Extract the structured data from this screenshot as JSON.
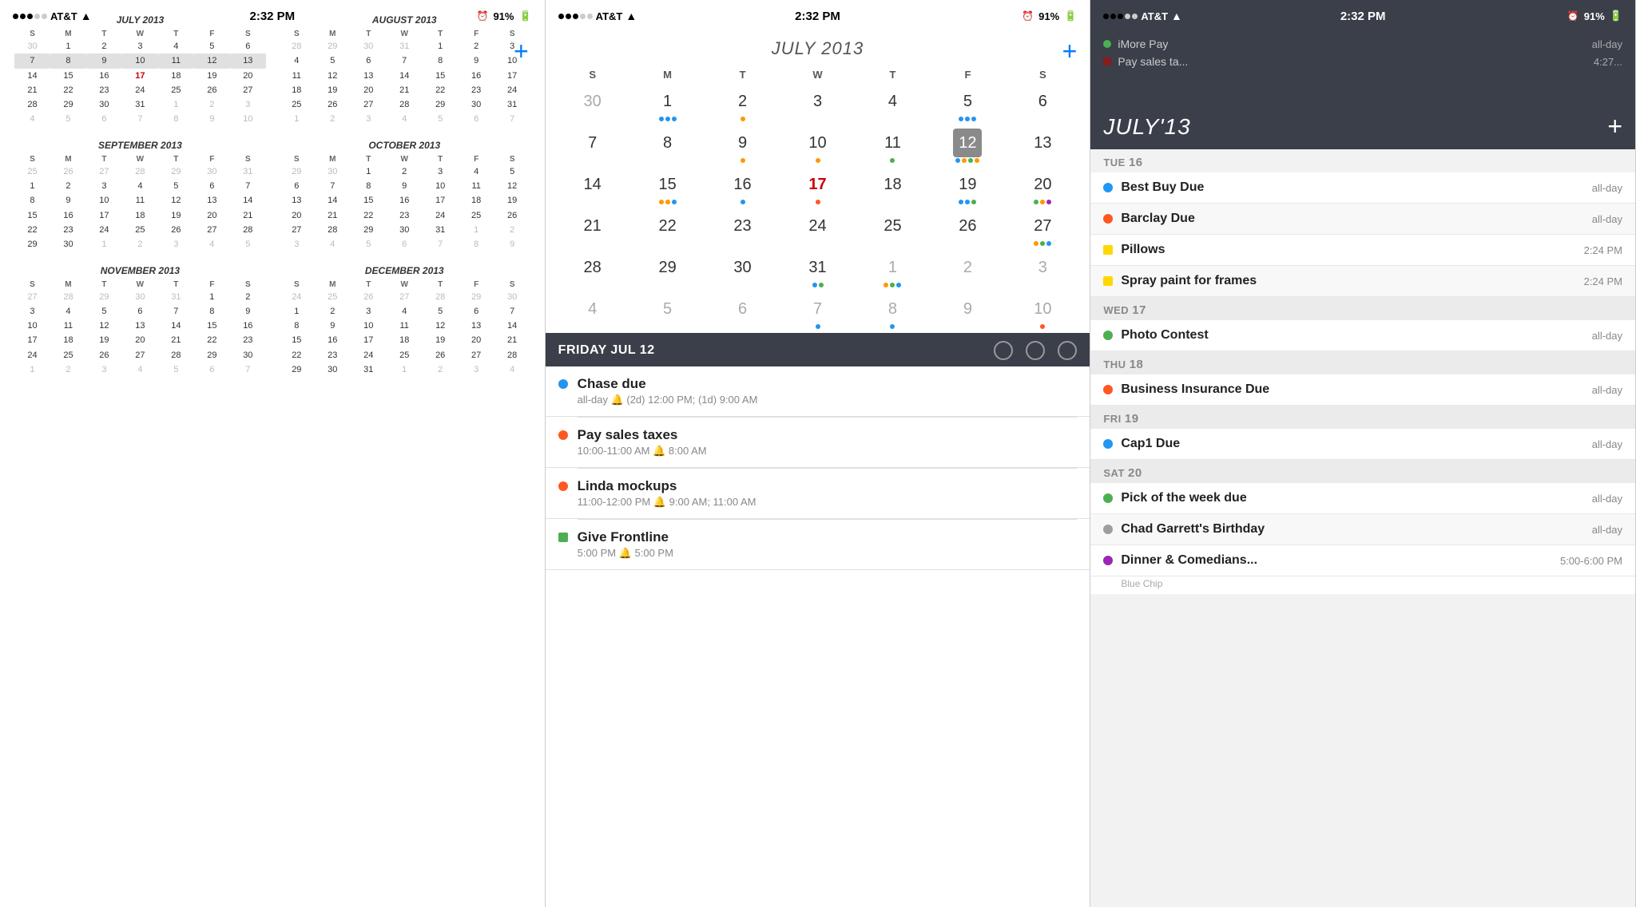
{
  "status": {
    "carrier": "AT&T",
    "time": "2:32 PM",
    "battery": "91%",
    "signal": [
      true,
      true,
      true,
      false,
      false
    ]
  },
  "panel1": {
    "add_label": "+",
    "months": [
      {
        "name": "JULY 2013",
        "headers": [
          "S",
          "M",
          "T",
          "W",
          "T",
          "F",
          "S"
        ],
        "weeks": [
          [
            "30",
            "1",
            "2",
            "3",
            "4",
            "5",
            "6"
          ],
          [
            "7",
            "8",
            "9",
            "10",
            "11",
            "12",
            "13"
          ],
          [
            "14",
            "15",
            "16",
            "17",
            "18",
            "19",
            "20"
          ],
          [
            "21",
            "22",
            "23",
            "24",
            "25",
            "26",
            "27"
          ],
          [
            "28",
            "29",
            "30",
            "31",
            "1",
            "2",
            "3"
          ],
          [
            "4",
            "5",
            "6",
            "7",
            "8",
            "9",
            "10"
          ]
        ],
        "other_month_days": [
          "30",
          "1",
          "2",
          "3",
          "4",
          "5",
          "6",
          "7",
          "8",
          "9",
          "10"
        ],
        "highlight_week": 1,
        "today": "17"
      },
      {
        "name": "AUGUST 2013",
        "headers": [
          "S",
          "M",
          "T",
          "W",
          "T",
          "F",
          "S"
        ],
        "weeks": [
          [
            "28",
            "29",
            "30",
            "31",
            "1",
            "2",
            "3"
          ],
          [
            "4",
            "5",
            "6",
            "7",
            "8",
            "9",
            "10"
          ],
          [
            "11",
            "12",
            "13",
            "14",
            "15",
            "16",
            "17"
          ],
          [
            "18",
            "19",
            "20",
            "21",
            "22",
            "23",
            "24"
          ],
          [
            "25",
            "26",
            "27",
            "28",
            "29",
            "30",
            "31"
          ],
          [
            "1",
            "2",
            "3",
            "4",
            "5",
            "6",
            "7"
          ]
        ]
      },
      {
        "name": "SEPTEMBER 2013",
        "headers": [
          "S",
          "M",
          "T",
          "W",
          "T",
          "F",
          "S"
        ],
        "weeks": [
          [
            "25",
            "26",
            "27",
            "28",
            "29",
            "30",
            "31"
          ],
          [
            "1",
            "2",
            "3",
            "4",
            "5",
            "6",
            "7"
          ],
          [
            "8",
            "9",
            "10",
            "11",
            "12",
            "13",
            "14"
          ],
          [
            "15",
            "16",
            "17",
            "18",
            "19",
            "20",
            "21"
          ],
          [
            "22",
            "23",
            "24",
            "25",
            "26",
            "27",
            "28"
          ],
          [
            "29",
            "30",
            "1",
            "2",
            "3",
            "4",
            "5"
          ]
        ]
      },
      {
        "name": "OCTOBER 2013",
        "headers": [
          "S",
          "M",
          "T",
          "W",
          "T",
          "F",
          "S"
        ],
        "weeks": [
          [
            "29",
            "30",
            "1",
            "2",
            "3",
            "4",
            "5"
          ],
          [
            "6",
            "7",
            "8",
            "9",
            "10",
            "11",
            "12"
          ],
          [
            "13",
            "14",
            "15",
            "16",
            "17",
            "18",
            "19"
          ],
          [
            "20",
            "21",
            "22",
            "23",
            "24",
            "25",
            "26"
          ],
          [
            "27",
            "28",
            "29",
            "30",
            "31",
            "1",
            "2"
          ],
          [
            "3",
            "4",
            "5",
            "6",
            "7",
            "8",
            "9"
          ]
        ]
      },
      {
        "name": "NOVEMBER 2013",
        "headers": [
          "S",
          "M",
          "T",
          "W",
          "T",
          "F",
          "S"
        ],
        "weeks": [
          [
            "27",
            "28",
            "29",
            "30",
            "31",
            "1",
            "2"
          ],
          [
            "3",
            "4",
            "5",
            "6",
            "7",
            "8",
            "9"
          ],
          [
            "10",
            "11",
            "12",
            "13",
            "14",
            "15",
            "16"
          ],
          [
            "17",
            "18",
            "19",
            "20",
            "21",
            "22",
            "23"
          ],
          [
            "24",
            "25",
            "26",
            "27",
            "28",
            "29",
            "30"
          ],
          [
            "1",
            "2",
            "3",
            "4",
            "5",
            "6",
            "7"
          ]
        ]
      },
      {
        "name": "DECEMBER 2013",
        "headers": [
          "S",
          "M",
          "T",
          "W",
          "T",
          "F",
          "S"
        ],
        "weeks": [
          [
            "24",
            "25",
            "26",
            "27",
            "28",
            "29",
            "30"
          ],
          [
            "1",
            "2",
            "3",
            "4",
            "5",
            "6",
            "7"
          ],
          [
            "8",
            "9",
            "10",
            "11",
            "12",
            "13",
            "14"
          ],
          [
            "15",
            "16",
            "17",
            "18",
            "19",
            "20",
            "21"
          ],
          [
            "22",
            "23",
            "24",
            "25",
            "26",
            "27",
            "28"
          ],
          [
            "29",
            "30",
            "31",
            "1",
            "2",
            "3",
            "4"
          ]
        ]
      }
    ]
  },
  "panel2": {
    "title": "JULY 2013",
    "add_label": "+",
    "headers": [
      "S",
      "M",
      "T",
      "W",
      "T",
      "F",
      "S"
    ],
    "weeks": [
      {
        "days": [
          {
            "num": "30",
            "other": true,
            "dots": []
          },
          {
            "num": "1",
            "dots": [
              "#2196F3",
              "#2196F3",
              "#2196F3"
            ]
          },
          {
            "num": "2",
            "dots": [
              "#FF9800"
            ]
          },
          {
            "num": "3",
            "dots": []
          },
          {
            "num": "4",
            "dots": []
          },
          {
            "num": "5",
            "dots": [
              "#2196F3",
              "#2196F3",
              "#2196F3"
            ]
          },
          {
            "num": "6",
            "dots": []
          }
        ]
      },
      {
        "days": [
          {
            "num": "7",
            "dots": []
          },
          {
            "num": "8",
            "dots": []
          },
          {
            "num": "9",
            "dots": [
              "#FF9800"
            ]
          },
          {
            "num": "10",
            "dots": [
              "#FF9800"
            ]
          },
          {
            "num": "11",
            "dots": [
              "#4CAF50"
            ]
          },
          {
            "num": "12",
            "selected": true,
            "dots": [
              "#2196F3",
              "#FF9800",
              "#4CAF50",
              "#FF9800"
            ]
          },
          {
            "num": "13",
            "dots": []
          }
        ]
      },
      {
        "days": [
          {
            "num": "14",
            "dots": []
          },
          {
            "num": "15",
            "dots": [
              "#FF9800",
              "#FF9800",
              "#2196F3"
            ]
          },
          {
            "num": "16",
            "dots": [
              "#2196F3"
            ]
          },
          {
            "num": "17",
            "today": true,
            "dots": [
              "#FF5722"
            ]
          },
          {
            "num": "18",
            "dots": []
          },
          {
            "num": "19",
            "dots": [
              "#2196F3",
              "#2196F3",
              "#4CAF50"
            ]
          },
          {
            "num": "20",
            "dots": [
              "#4CAF50",
              "#FF9800",
              "#9C27B0"
            ]
          }
        ]
      },
      {
        "days": [
          {
            "num": "21",
            "dots": []
          },
          {
            "num": "22",
            "dots": []
          },
          {
            "num": "23",
            "dots": []
          },
          {
            "num": "24",
            "dots": []
          },
          {
            "num": "25",
            "dots": []
          },
          {
            "num": "26",
            "dots": []
          },
          {
            "num": "27",
            "dots": [
              "#FF9800",
              "#4CAF50",
              "#2196F3"
            ]
          }
        ]
      },
      {
        "days": [
          {
            "num": "28",
            "dots": []
          },
          {
            "num": "29",
            "dots": []
          },
          {
            "num": "30",
            "dots": []
          },
          {
            "num": "31",
            "dots": [
              "#2196F3",
              "#4CAF50"
            ]
          },
          {
            "num": "1",
            "other": true,
            "dots": [
              "#FF9800",
              "#4CAF50",
              "#2196F3"
            ]
          },
          {
            "num": "2",
            "other": true,
            "dots": []
          },
          {
            "num": "3",
            "other": true,
            "dots": []
          }
        ]
      },
      {
        "days": [
          {
            "num": "4",
            "other": true,
            "dots": []
          },
          {
            "num": "5",
            "other": true,
            "dots": []
          },
          {
            "num": "6",
            "other": true,
            "dots": []
          },
          {
            "num": "7",
            "other": true,
            "dots": [
              "#2196F3"
            ]
          },
          {
            "num": "8",
            "other": true,
            "dots": [
              "#2196F3"
            ]
          },
          {
            "num": "9",
            "other": true,
            "dots": []
          },
          {
            "num": "10",
            "other": true,
            "dots": [
              "#FF5722"
            ]
          }
        ]
      }
    ],
    "day_detail": {
      "title": "FRIDAY JUL 12",
      "icons": [
        "○",
        "○",
        "○"
      ]
    },
    "events": [
      {
        "color": "#2196F3",
        "shape": "circle",
        "title": "Chase due",
        "subtitle": "all-day  🔔 (2d) 12:00 PM; (1d) 9:00 AM"
      },
      {
        "color": "#FF5722",
        "shape": "circle",
        "title": "Pay sales taxes",
        "subtitle": "10:00-11:00 AM  🔔 8:00 AM"
      },
      {
        "color": "#FF5722",
        "shape": "circle",
        "title": "Linda mockups",
        "subtitle": "11:00-12:00 PM  🔔 9:00 AM; 11:00 AM"
      },
      {
        "color": "#4CAF50",
        "shape": "square",
        "title": "Give Frontline",
        "subtitle": "5:00 PM  🔔 5:00 PM"
      }
    ]
  },
  "panel3": {
    "title": "JULY'13",
    "add_label": "+",
    "above_items": [
      {
        "color": "#4CAF50",
        "shape": "circle",
        "title": "iMore Pay",
        "time": "all-day"
      },
      {
        "color": "#8B1A1A",
        "shape": "square",
        "title": "Pay sales ta...",
        "time": "4:27..."
      }
    ],
    "sections": [
      {
        "day_label": "TUE",
        "day_num": "16",
        "events": [
          {
            "color": "#2196F3",
            "shape": "circle",
            "title": "Best Buy Due",
            "time": "all-day"
          },
          {
            "color": "#FF5722",
            "shape": "circle",
            "title": "Barclay Due",
            "time": "all-day"
          },
          {
            "color": "#FFD700",
            "shape": "square",
            "title": "Pillows",
            "time": "2:24 PM"
          },
          {
            "color": "#FFD700",
            "shape": "square",
            "title": "Spray paint for frames",
            "time": "2:24 PM"
          }
        ]
      },
      {
        "day_label": "WED",
        "day_num": "17",
        "events": [
          {
            "color": "#4CAF50",
            "shape": "circle",
            "title": "Photo Contest",
            "time": "all-day"
          }
        ]
      },
      {
        "day_label": "THU",
        "day_num": "18",
        "events": [
          {
            "color": "#FF5722",
            "shape": "circle",
            "title": "Business Insurance Due",
            "time": "all-day"
          }
        ]
      },
      {
        "day_label": "FRI",
        "day_num": "19",
        "events": [
          {
            "color": "#2196F3",
            "shape": "circle",
            "title": "Cap1 Due",
            "time": "all-day"
          }
        ]
      },
      {
        "day_label": "SAT",
        "day_num": "20",
        "events": [
          {
            "color": "#4CAF50",
            "shape": "circle",
            "title": "Pick of the week due",
            "time": "all-day"
          },
          {
            "color": "#9E9E9E",
            "shape": "circle",
            "title": "Chad Garrett's Birthday",
            "time": "all-day"
          },
          {
            "color": "#9C27B0",
            "shape": "circle",
            "title": "Dinner & Comedians...",
            "time": "5:00-6:00 PM",
            "sub": "Blue Chip"
          }
        ]
      }
    ]
  }
}
